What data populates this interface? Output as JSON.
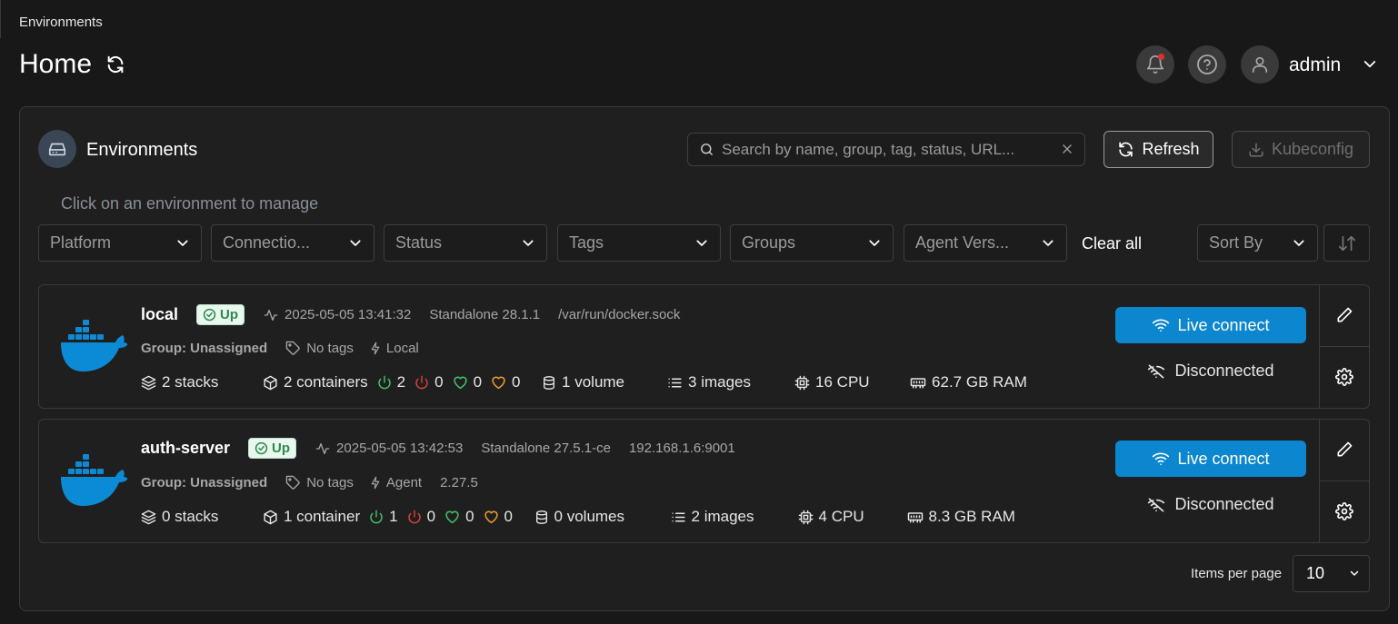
{
  "breadcrumb": "Environments",
  "header": {
    "title": "Home",
    "user": "admin"
  },
  "panel": {
    "title": "Environments",
    "hint": "Click on an environment to manage",
    "search_placeholder": "Search by name, group, tag, status, URL...",
    "refresh_label": "Refresh",
    "kubeconfig_label": "Kubeconfig"
  },
  "filters": [
    "Platform",
    "Connectio...",
    "Status",
    "Tags",
    "Groups",
    "Agent Vers..."
  ],
  "clear_all": "Clear all",
  "sort_by": "Sort By",
  "environments": [
    {
      "name": "local",
      "status": "Up",
      "heartbeat": "2025-05-05 13:41:32",
      "type": "Standalone 28.1.1",
      "url": "/var/run/docker.sock",
      "group": "Group: Unassigned",
      "tags": "No tags",
      "connection": "Local",
      "agent_version": "",
      "stacks": "2 stacks",
      "containers": "2 containers",
      "running": "2",
      "stopped": "0",
      "healthy": "0",
      "unhealthy": "0",
      "volumes": "1 volume",
      "images": "3 images",
      "cpu": "16 CPU",
      "ram": "62.7 GB RAM",
      "live_connect": "Live connect",
      "disconnected": "Disconnected"
    },
    {
      "name": "auth-server",
      "status": "Up",
      "heartbeat": "2025-05-05 13:42:53",
      "type": "Standalone 27.5.1-ce",
      "url": "192.168.1.6:9001",
      "group": "Group: Unassigned",
      "tags": "No tags",
      "connection": "Agent",
      "agent_version": "2.27.5",
      "stacks": "0 stacks",
      "containers": "1 container",
      "running": "1",
      "stopped": "0",
      "healthy": "0",
      "unhealthy": "0",
      "volumes": "0 volumes",
      "images": "2 images",
      "cpu": "4 CPU",
      "ram": "8.3 GB RAM",
      "live_connect": "Live connect",
      "disconnected": "Disconnected"
    }
  ],
  "pagination": {
    "items_per_page_label": "Items per page",
    "items_per_page": "10"
  },
  "colors": {
    "accent": "#0b86cf",
    "status_up": "#2d8a4e",
    "running": "#3fbf6a",
    "stopped": "#d6403a",
    "healthy": "#3fbf6a",
    "unhealthy": "#e89a2c"
  }
}
